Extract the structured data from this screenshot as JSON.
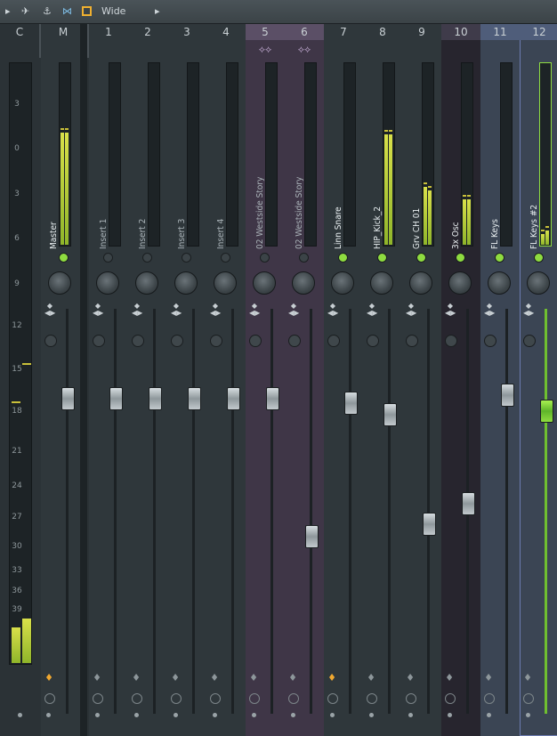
{
  "toolbar": {
    "view_mode": "Wide"
  },
  "colors": {
    "purple": "#3f3647",
    "dark_purple": "#27252e",
    "blue": "#3b4554",
    "selected": "#8fdc40"
  },
  "scale": {
    "labels": [
      "3",
      "0",
      "3",
      "6",
      "9",
      "12",
      "15",
      "18",
      "21",
      "24",
      "27",
      "30",
      "33",
      "36",
      "39"
    ]
  },
  "tracks": [
    {
      "number": "C",
      "name": "",
      "type": "current"
    },
    {
      "number": "M",
      "name": "Master",
      "type": "master",
      "led": "green",
      "fader": 0.78,
      "meter": [
        0.62,
        0.62
      ]
    },
    {
      "number": "1",
      "name": "Insert 1",
      "led": "off",
      "fader": 0.78
    },
    {
      "number": "2",
      "name": "Insert 2",
      "led": "off",
      "fader": 0.78
    },
    {
      "number": "3",
      "name": "Insert 3",
      "led": "off",
      "fader": 0.78
    },
    {
      "number": "4",
      "name": "Insert 4",
      "led": "off",
      "fader": 0.78
    },
    {
      "number": "5",
      "name": "02 Westside Story",
      "led": "off",
      "fader": 0.78,
      "color": "purple",
      "wave": true
    },
    {
      "number": "6",
      "name": "02 Westside Story",
      "led": "off",
      "fader": 0.44,
      "color": "purple",
      "wave": true
    },
    {
      "number": "7",
      "name": "Linn Snare",
      "led": "green",
      "fader": 0.77,
      "route_active": true
    },
    {
      "number": "8",
      "name": "HIP_Kick_2",
      "led": "green",
      "fader": 0.74,
      "meter": [
        0.61,
        0.61
      ]
    },
    {
      "number": "9",
      "name": "Grv CH 01",
      "led": "green",
      "fader": 0.47,
      "meter": [
        0.32,
        0.3
      ]
    },
    {
      "number": "10",
      "name": "3x Osc",
      "led": "green",
      "fader": 0.52,
      "meter": [
        0.25,
        0.25
      ],
      "color": "dark_purple"
    },
    {
      "number": "11",
      "name": "FL Keys",
      "led": "green",
      "fader": 0.79,
      "color": "blue"
    },
    {
      "number": "12",
      "name": "FL Keys #2",
      "led": "green",
      "fader": 0.75,
      "color": "blue",
      "selected": true,
      "meter": [
        0.06,
        0.08
      ]
    }
  ]
}
